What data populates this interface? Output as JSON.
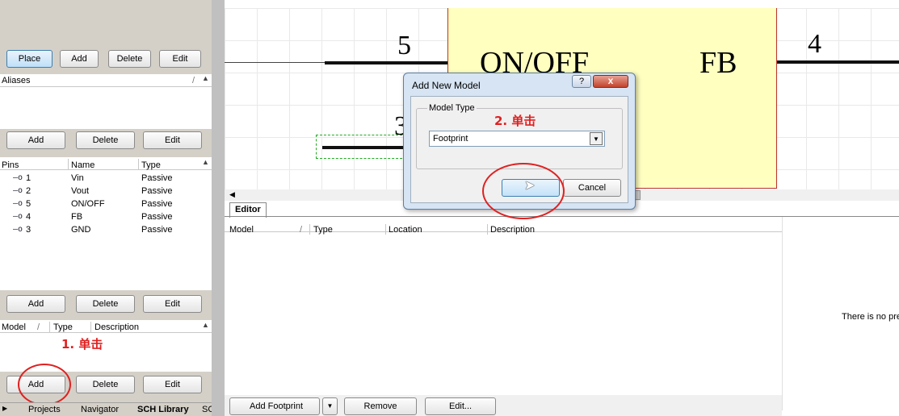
{
  "left_panel": {
    "top_buttons": [
      "Place",
      "Add",
      "Delete",
      "Edit"
    ],
    "aliases": {
      "header": "Aliases",
      "sort_glyph": "/"
    },
    "pins_buttons": [
      "Add",
      "Delete",
      "Edit"
    ],
    "pins": {
      "headers": [
        "Pins",
        "Name",
        "Type"
      ],
      "rows": [
        {
          "pin": "1",
          "name": "Vin",
          "type": "Passive"
        },
        {
          "pin": "2",
          "name": "Vout",
          "type": "Passive"
        },
        {
          "pin": "5",
          "name": "ON/OFF",
          "type": "Passive"
        },
        {
          "pin": "4",
          "name": "FB",
          "type": "Passive"
        },
        {
          "pin": "3",
          "name": "GND",
          "type": "Passive"
        }
      ]
    },
    "models_buttons": [
      "Add",
      "Delete",
      "Edit"
    ],
    "models": {
      "headers": [
        "Model",
        "/",
        "Type",
        "Description"
      ]
    },
    "bottom_buttons": [
      "Add",
      "Delete",
      "Edit"
    ],
    "annotation_1": "1. 单击",
    "tabs": [
      "Projects",
      "Navigator",
      "SCH Library",
      "SCH"
    ]
  },
  "schematic": {
    "pin5_number": "5",
    "pin4_number": "4",
    "onoff_label": "ON/OFF",
    "fb_label": "FB",
    "hidden_pin_number": "3",
    "component_fill": "#ffffc0"
  },
  "dialog": {
    "title": "Add New Model",
    "help_label": "?",
    "close_label": "x",
    "group_label": "Model Type",
    "selected_value": "Footprint",
    "annotation_2": "2. 单击",
    "ok_label": "",
    "cancel_label": "Cancel"
  },
  "editor": {
    "tab_label": "Editor",
    "columns": [
      "Model",
      "/",
      "Type",
      "Location",
      "Description"
    ],
    "buttons": {
      "add_footprint": "Add Footprint",
      "remove": "Remove",
      "edit": "Edit..."
    },
    "preview_text": "There is no pre"
  },
  "colors": {
    "annotation": "#e02020",
    "panel_bg": "#d4d0c8",
    "dialog_title_bg": "#c8dcf0"
  }
}
